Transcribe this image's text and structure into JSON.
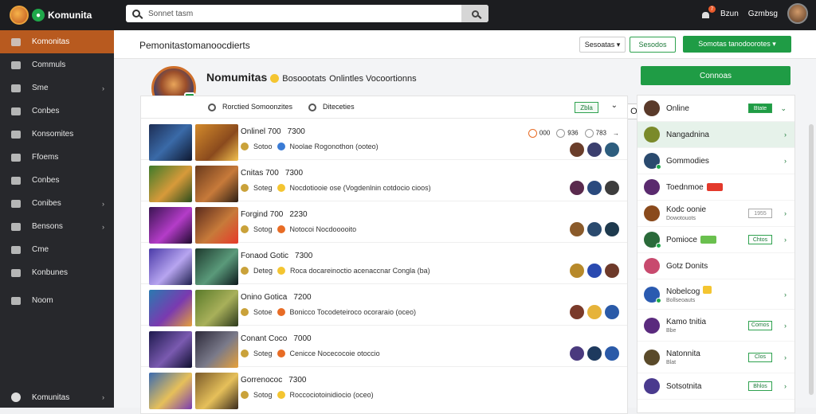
{
  "app": {
    "name": "Komunita"
  },
  "search": {
    "placeholder": "Sonnet tasm"
  },
  "topbar": {
    "notif_count": "7",
    "link1": "Bzun",
    "link2": "Gzmbsg"
  },
  "sidebar": {
    "items": [
      {
        "label": "Komonitas",
        "active": true
      },
      {
        "label": "Commuls"
      },
      {
        "label": "Sme",
        "chev": "›"
      },
      {
        "label": "Conbes"
      },
      {
        "label": "Konsomites"
      },
      {
        "label": "Ffoems"
      },
      {
        "label": "Conbes"
      },
      {
        "label": "Conibes",
        "chev": "›"
      },
      {
        "label": "Bensons",
        "chev": "›"
      },
      {
        "label": "Cme"
      },
      {
        "label": "Konbunes"
      },
      {
        "label": "Noom"
      }
    ],
    "bottom": {
      "label": "Komunitas",
      "chev": "›"
    }
  },
  "header": {
    "title": "Pemonitastomanoocdierts",
    "btn1": "Sesoatas ▾",
    "btn2": "Sesodos",
    "btn3": "Somotas tanodoorotes ▾"
  },
  "profile": {
    "name": "Nomumitas",
    "subtitle": "Bosoootats",
    "extra": "Onlintles Vocoortionns",
    "meta1": "Rorctied Somoonzites",
    "meta2": "Diteceties",
    "btn": "‹ O"
  },
  "right_panel": {
    "top_button": "Connoas",
    "items": [
      {
        "name": "Online",
        "pill": "Btate",
        "pill_style": "solid",
        "arrow": "⌄"
      },
      {
        "name": "Nangadnina",
        "arrow": "›",
        "highlight": true
      },
      {
        "name": "Gommodies",
        "arrow": "›"
      },
      {
        "name": "Toednmoe",
        "tag": "red"
      },
      {
        "name": "Kodc oonie",
        "sub": "Dowotouots",
        "pill": "1955",
        "arrow": "›"
      },
      {
        "name": "Pomioce",
        "tag": "green",
        "pill": "Chtos",
        "arrow": "›"
      },
      {
        "name": "Gotz Donits"
      },
      {
        "name": "Nobelcog",
        "sub": "Bollseoauts",
        "tag": "red",
        "arrow": "›"
      },
      {
        "name": "Kamo tnitia",
        "sub": "Bbe",
        "pill": "Comos",
        "arrow": "›"
      },
      {
        "name": "Natonnita",
        "sub": "Blat",
        "pill": "Clos",
        "arrow": "›"
      },
      {
        "name": "Sotsotnita",
        "pill": "Bhlos",
        "arrow": "›"
      }
    ]
  },
  "feed": {
    "filter_pill": "Zbla",
    "rows": [
      {
        "title": "Onlinel 700",
        "num": "7300",
        "meta_a": "Sotoo",
        "meta_b": "Noolae Rogonothon (ooteo)",
        "stats": [
          "000",
          "936",
          "783",
          "→"
        ]
      },
      {
        "title": "Cnitas 700",
        "num": "7300",
        "meta_a": "Soteg",
        "meta_b": "Nocdotiooie ose (Vogdenlnin cotdocio cioos)"
      },
      {
        "title": "Forgind 700",
        "num": "2230",
        "meta_a": "Sotog",
        "meta_b": "Notocoi Nocdooooito"
      },
      {
        "title": "Fonaod Gotic",
        "num": "7300",
        "meta_a": "Deteg",
        "meta_b": "Roca docareinoctio acenaccnar Congla (ba)"
      },
      {
        "title": "Onino Gotica",
        "num": "7200",
        "meta_a": "Sotoe",
        "meta_b": "Bonicco Tocodeteiroco ocoraraio (oceo)"
      },
      {
        "title": "Conant Coco",
        "num": "7000",
        "meta_a": "Soteg",
        "meta_b": "Cenicce Nocecocoie otoccio"
      },
      {
        "title": "Gorrenococ",
        "num": "7300",
        "meta_a": "Sotog",
        "meta_b": "Roccociotoinidiocio (oceo)"
      }
    ]
  },
  "colors": {
    "accent": "#1f9c45",
    "sidebar_active": "#b85a1f",
    "sidebar_bg": "#27282c",
    "topbar_bg": "#1c1d20"
  }
}
